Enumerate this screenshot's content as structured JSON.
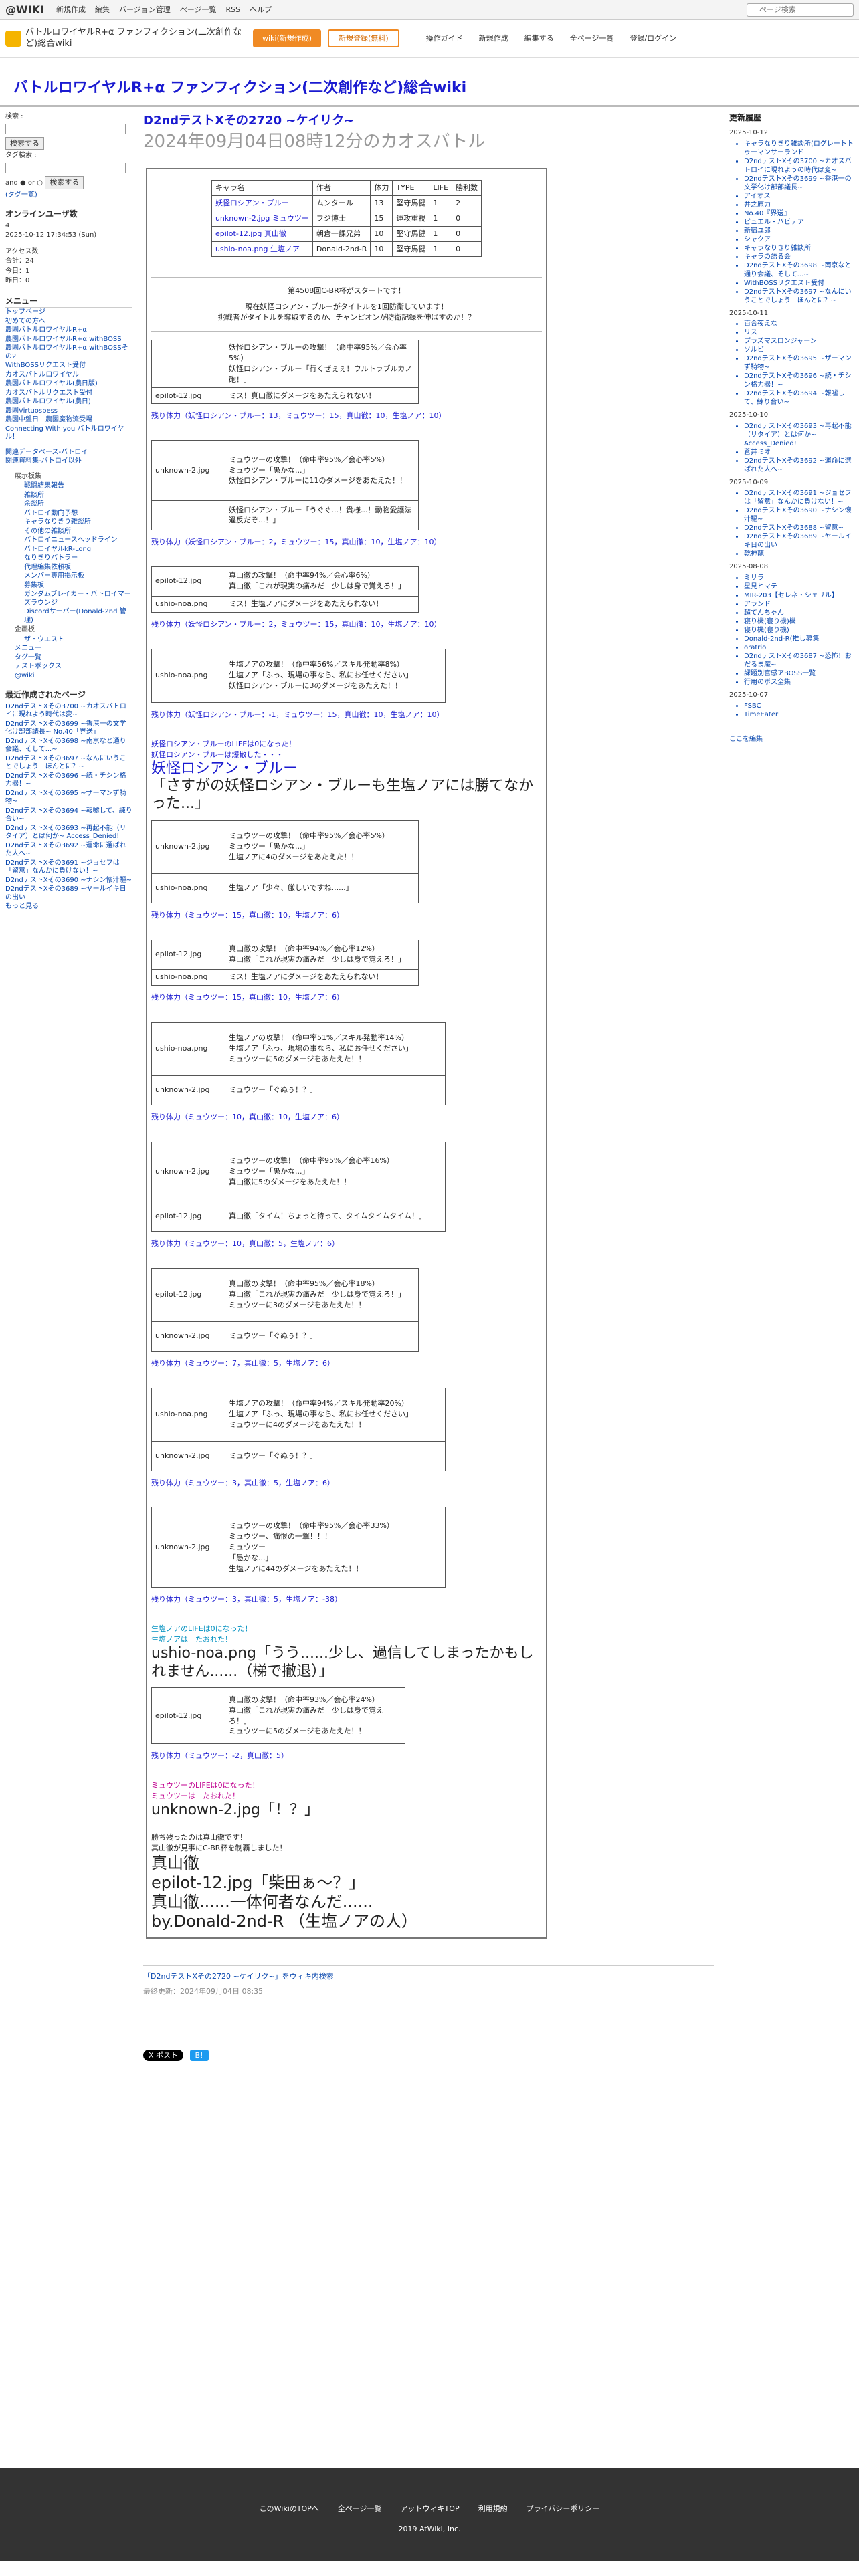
{
  "topbar": {
    "logo": "@WIKI",
    "menus": [
      "新規作成",
      "編集",
      "バージョン管理",
      "ページ一覧",
      "RSS",
      "ヘルプ"
    ],
    "search_placeholder": "ページ検索"
  },
  "header": {
    "site_name": "バトルロワイヤルR+α ファンフィクション(二次創作など)総合wiki",
    "btn_new": "wiki(新規作成)",
    "btn_reg": "新規登録(無料)",
    "links": [
      "操作ガイド",
      "新規作成",
      "編集する",
      "全ページ一覧",
      "登録/ログイン"
    ]
  },
  "title": "バトルロワイヤルR+α ファンフィクション(二次創作など)総合wiki",
  "left": {
    "search_label": "検索 :",
    "search_btn": "検索する",
    "tag_label": "タグ検索 :",
    "andor": "and ● or ○",
    "tag_btn": "検索する",
    "tag_link": "(タグ一覧)",
    "online_label": "オンラインユーザ数",
    "online_count": "4",
    "datetime": "2025-10-12 17:34:53 (Sun)",
    "access_label": "アクセス数",
    "access_total": "合計：24",
    "access_today": "今日：1",
    "access_yesterday": "昨日：0",
    "menu_title": "メニュー",
    "menu_items": [
      "トップページ",
      "初めての方へ",
      "農園バトルロワイヤルR+α",
      "農園バトルロワイヤルR+α withBOSS",
      "農園バトルロワイヤルR+α withBOSSその2",
      "WithBOSSリクエスト受付",
      "カオスバトルロワイヤル",
      "農園バトルロワイヤル(農日版)",
      "カオスバトルリクエスト受付",
      "農園バトルロワイヤル(農日)",
      "農園Virtuosbess",
      "農園中盤日　農園魔物流受場",
      "Connecting With you バトルロワイヤル！"
    ],
    "sub1": "関連データベース-バトロイ",
    "sub2": "関連資料集-バトロイ以外",
    "display_title": "展示板集",
    "display_items": [
      "戦闘結果報告",
      "雑談所",
      "余談所",
      "バトロイ動向予想",
      "キャラなりきり雑談所",
      "その他の雑談所",
      "バトロイニュースへッドライン",
      "バトロイヤルkR-Long",
      "なりきりバトラー",
      "代理編集依頼板",
      "メンバー専用掲示板",
      "募集板",
      "ガンダムブレイカー・バトロイマーズラウンジ",
      "Discordサーバー(Donald-2nd 管理)"
    ],
    "other_title": "企画板",
    "other_items": [
      "ザ・ウエスト"
    ],
    "extra_items": [
      "メニュー",
      "タグ一覧",
      "テストボックス",
      "@wiki"
    ],
    "recent_title": "最近作成されたページ",
    "recent_items": [
      "D2ndテストXその3700 ~カオスバトロイに現れよう時代は変~",
      "D2ndテストXその3699 ~香港一の文学化け部部議長~ No.40「界送」",
      "D2ndテストXその3698 ~南京なと通り会議、そして...~",
      "D2ndテストXその3697 ~なんにいうことでしょう　ほんとに？~",
      "D2ndテストXその3696 ~続・チシン格力器！~",
      "D2ndテストXその3695 ~ザーマンず騎物~",
      "D2ndテストXその3694 ~報嘘して、練り合い~",
      "D2ndテストXその3693 ~再起不能（リタイア）とは何か~ Access_Denied!",
      "D2ndテストXその3692 ~運命に選ばれた人へ~",
      "D2ndテストXその3691 ~ジョセフは「留意」なんかに負けない！~",
      "D2ndテストXその3690 ~ナシン懐汁驅~",
      "D2ndテストXその3689 ~ヤールイキ日の出い"
    ],
    "more": "もっと見る"
  },
  "main": {
    "page_title": "D2ndテストXその2720 ~ケイリク~",
    "date_title": "2024年09月04日08時12分のカオスバトル",
    "table_headers": [
      "キャラ名",
      "作者",
      "体力",
      "TYPE",
      "LIFE",
      "勝利数"
    ],
    "table_rows": [
      [
        "妖怪ロシアン・ブルー",
        "ムンタール",
        "13",
        "堅守馬健",
        "1",
        "2"
      ],
      [
        "unknown-2.jpg ミュウツー",
        "フジ博士",
        "15",
        "運攻重視",
        "1",
        "0"
      ],
      [
        "epilot-12.jpg 真山徹",
        "朝倉一課兄弟",
        "10",
        "堅守馬健",
        "1",
        "0"
      ],
      [
        "ushio-noa.png 生塩ノア",
        "Donald-2nd-R",
        "10",
        "堅守馬健",
        "1",
        "0"
      ]
    ],
    "intro1": "第4508回C-BR杯がスタートです！",
    "intro2": "現在妖怪ロシアン・ブルーがタイトルを1回防衛しています！",
    "intro3": "挑戦者がタイトルを奪取するのか、チャンピオンが防衛記録を伸ばすのか！？",
    "lines": [
      "妖怪ロシアン・ブルーの攻撃！（命中率95%／会心率5%）",
      "妖怪ロシアン・ブルー「行くぜぇぇ！ウルトラブルカノ砲！」",
      "ミス！真山徹にダメージをあたえられない！",
      "残り体力（妖怪ロシアン・ブルー：13，ミュウツー：15，真山徹：10，生塩ノア：10）",
      "ミュウツーの攻撃！（命中率95%／会心率5%）",
      "ミュウツー「愚かな...」",
      "妖怪ロシアン・ブルーに11のダメージをあたえた！！",
      "妖怪ロシアン・ブルー「うぐぐ...！貴様...！動物愛護法違反だぞ...！」",
      "残り体力（妖怪ロシアン・ブルー：2，ミュウツー：15，真山徹：10，生塩ノア：10）",
      "真山徹の攻撃！（命中率94%／会心率6%）",
      "真山徹「これが現実の痛みだ　少しは身で覚えろ！」",
      "ミス！生塩ノアにダメージをあたえられない！",
      "残り体力（妖怪ロシアン・ブルー：2，ミュウツー：15，真山徹：10，生塩ノア：10）",
      "生塩ノアの攻撃！（命中率56%／スキル発動率8%）",
      "生塩ノア「ふっ、現場の事なら、私にお任せください」",
      "妖怪ロシアン・ブルーに3のダメージをあたえた！！",
      "残り体力（妖怪ロシアン・ブルー：-1，ミュウツー：15，真山徹：10，生塩ノア：10）",
      "妖怪ロシアン・ブルーのLIFEは0になった！",
      "妖怪ロシアン・ブルーは爆散した・・・",
      "妖怪ロシアン・ブルー",
      "「さすがの妖怪ロシアン・ブルーも生塩ノアには勝てなかった...」",
      "ミュウツーの攻撃！（命中率95%／会心率5%）",
      "ミュウツー「愚かな...」",
      "生塩ノアに4のダメージをあたえた！！",
      "生塩ノア「少々、厳しいですね......」",
      "残り体力（ミュウツー：15，真山徹：10，生塩ノア：6）",
      "真山徹の攻撃！（命中率94%／会心率12%）",
      "真山徹「これが現実の痛みだ　少しは身で覚えろ！」",
      "ミス！生塩ノアにダメージをあたえられない！",
      "残り体力（ミュウツー：15，真山徹：10，生塩ノア：6）",
      "生塩ノアの攻撃！（命中率51%／スキル発動率14%）",
      "生塩ノア「ふっ、現場の事なら、私にお任せください」",
      "ミュウツーに5のダメージをあたえた！！",
      "ミュウツー「ぐぬぅ！？」",
      "残り体力（ミュウツー：10，真山徹：10，生塩ノア：6）",
      "ミュウツーの攻撃！（命中率95%／会心率16%）",
      "ミュウツー「愚かな...」",
      "真山徹に5のダメージをあたえた！！",
      "真山徹「タイム！ちょっと待って、タイムタイムタイム！」",
      "残り体力（ミュウツー：10，真山徹：5，生塩ノア：6）",
      "真山徹の攻撃！（命中率95%／会心率18%）",
      "真山徹「これが現実の痛みだ　少しは身で覚えろ！」",
      "ミュウツーに3のダメージをあたえた！！",
      "ミュウツー「ぐぬぅ！？」",
      "残り体力（ミュウツー：7，真山徹：5，生塩ノア：6）",
      "生塩ノアの攻撃！（命中率94%／スキル発動率20%）",
      "生塩ノア「ふっ、現場の事なら、私にお任せください」",
      "ミュウツーに4のダメージをあたえた！！",
      "ミュウツー「ぐぬぅ！？」",
      "残り体力（ミュウツー：3，真山徹：5，生塩ノア：6）",
      "ミュウツーの攻撃！（命中率95%／会心率33%）",
      "ミュウツー、痛恨の一撃！！！",
      "ミュウツー",
      "「愚かな...」",
      "生塩ノアに44のダメージをあたえた！！",
      "残り体力（ミュウツー：3，真山徹：5，生塩ノア：-38）",
      "生塩ノアのLIFEは0になった！",
      "生塩ノアは　たおれた！",
      "ushio-noa.png「うう......少し、過信してしまったかもしれません......（梯で撤退）」",
      "真山徹の攻撃！（命中率93%／会心率24%）",
      "真山徹「これが現実の痛みだ　少しは身で覚えろ！」",
      "ミュウツーに5のダメージをあたえた！！",
      "残り体力（ミュウツー：-2，真山徹：5）",
      "ミュウツーのLIFEは0になった！",
      "ミュウツーは　たおれた！",
      "unknown-2.jpg「！？」",
      "勝ち残ったのは真山徹です！",
      "真山徹が見事にC-BR杯を制覇しました！",
      "真山徹",
      "epilot-12.jpg「柴田ぁ～？」",
      "真山徹......一体何者なんだ......",
      "by.Donald-2nd-R （生塩ノアの人）"
    ],
    "img_unknown": "unknown-2.jpg",
    "img_epilot": "epilot-12.jpg",
    "img_ushio": "ushio-noa.png",
    "search_link": "「D2ndテストXその2720 ~ケイリク~」をウィキ内検索",
    "last_updated": "最終更新：2024年09月04日 08:35",
    "share_x": "X ポスト",
    "share_b": "B!"
  },
  "right": {
    "title": "更新履歴",
    "groups": [
      {
        "date": "2025-10-12",
        "items": [
          "キャラなりきり雑談所(ログレートトゥーマンサーランド",
          "D2ndテストXその3700 ~カオスバトロイに現れようの時代は変~",
          "D2ndテストXその3699 ~香港一の文学化け部部議長~",
          "アイオス",
          "井之原力",
          "No.40『界送』",
          "ピュエル・バビテア",
          "新宿ユ郎",
          "シャクア",
          "キャラなりきり雑談所",
          "キャラの語る会",
          "D2ndテストXその3698 ~南京なと通り会議、そして...~",
          "WithBOSSリクエスト受付",
          "D2ndテストXその3697 ~なんにいうことでしょう　ほんとに？~"
        ]
      },
      {
        "date": "2025-10-11",
        "items": [
          "百合夜えな",
          "リス",
          "プラズマスロンジャーン",
          "ソルビ",
          "D2ndテストXその3695 ~ザーマンず騎物~",
          "D2ndテストXその3696 ~続・チシン格力器！~",
          "D2ndテストXその3694 ~報嘘して、練り合い~"
        ]
      },
      {
        "date": "2025-10-10",
        "items": [
          "D2ndテストXその3693 ~再起不能（リタイア）とは何か~ Access_Denied!",
          "蒼井ミオ",
          "D2ndテストXその3692 ~運命に選ばれた人へ~"
        ]
      },
      {
        "date": "2025-10-09",
        "items": [
          "D2ndテストXその3691 ~ジョセフは「留意」なんかに負けない！~",
          "D2ndテストXその3690 ~ナシン懐汁驅~",
          "D2ndテストXその3688 ~留意~",
          "D2ndテストXその3689 ~ヤールイキ日の出い",
          "乾神龍"
        ]
      },
      {
        "date": "2025-08-08",
        "items": [
          "ミリラ",
          "星見ヒマテ",
          "MIR-203【セレネ・シェリル】",
          "アランド",
          "超てんちゃん",
          "寝り機(寝り機)機",
          "寝り機(寝り機)",
          "Donald-2nd-R(推し募集",
          "oratrio",
          "D2ndテストXその3687 ~恐怖！おだるま魔~",
          "課題別宮感アBOSS一覧",
          "行用のボス全集"
        ]
      },
      {
        "date": "2025-10-07",
        "items": [
          "FSBC",
          "TimeEater"
        ]
      }
    ],
    "more": "ここを編集"
  },
  "footer": {
    "links": [
      "このWikiのTOPへ",
      "全ページ一覧",
      "アットウィキTOP",
      "利用規約",
      "プライバシーポリシー"
    ],
    "copy": "2019 AtWiki, Inc."
  }
}
